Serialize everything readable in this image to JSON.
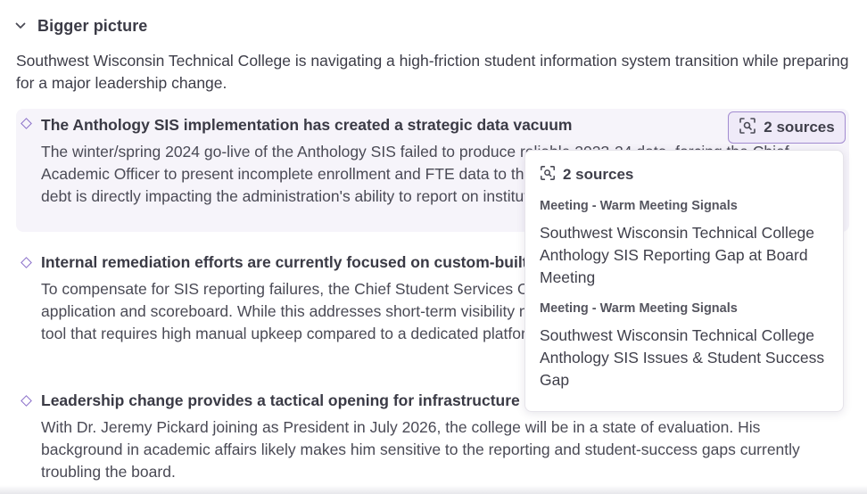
{
  "section": {
    "title": "Bigger picture",
    "collapse_icon": "chevron-down-icon"
  },
  "intro": "Southwest Wisconsin Technical College is navigating a high-friction student information system transition while preparing for a major leadership change.",
  "items": [
    {
      "title": "The Anthology SIS implementation has created a strategic data vacuum",
      "body": "The winter/spring 2024 go-live of the Anthology SIS failed to produce reliable 2023-24 data, forcing the Chief Academic Officer to present incomplete enrollment and FTE data to the board in January 2026. This technical debt is directly impacting the administration's ability to report on institutional health."
    },
    {
      "title": "Internal remediation efforts are currently focused on custom-built reporting workarounds",
      "body": "To compensate for SIS reporting failures, the Chief Student Services Officer is developing a Student Success application and scoreboard. While this addresses short-term visibility needs, it risks creating another fragmented tool that requires high manual upkeep compared to a dedicated platform like Stellic."
    },
    {
      "title": "Leadership change provides a tactical opening for infrastructure review",
      "body": "With Dr. Jeremy Pickard joining as President in July 2026, the college will be in a state of evaluation. His background in academic affairs likely makes him sensitive to the reporting and student-success gaps currently troubling the board."
    }
  ],
  "sources_button": {
    "label": "2 sources",
    "icon": "search-document-icon"
  },
  "popover": {
    "heading": "2 sources",
    "icon": "search-document-icon",
    "sources": [
      {
        "type": "Meeting - Warm Meeting Signals",
        "title": "Southwest Wisconsin Technical College Anthology SIS Reporting Gap at Board Meeting"
      },
      {
        "type": "Meeting - Warm Meeting Signals",
        "title": "Southwest Wisconsin Technical College Anthology SIS Issues & Student Success Gap"
      }
    ]
  },
  "colors": {
    "accent": "#8a6fc9",
    "highlight_bg": "#f6f4fa",
    "button_bg": "#efeaf8",
    "button_border": "#a28bd0"
  }
}
